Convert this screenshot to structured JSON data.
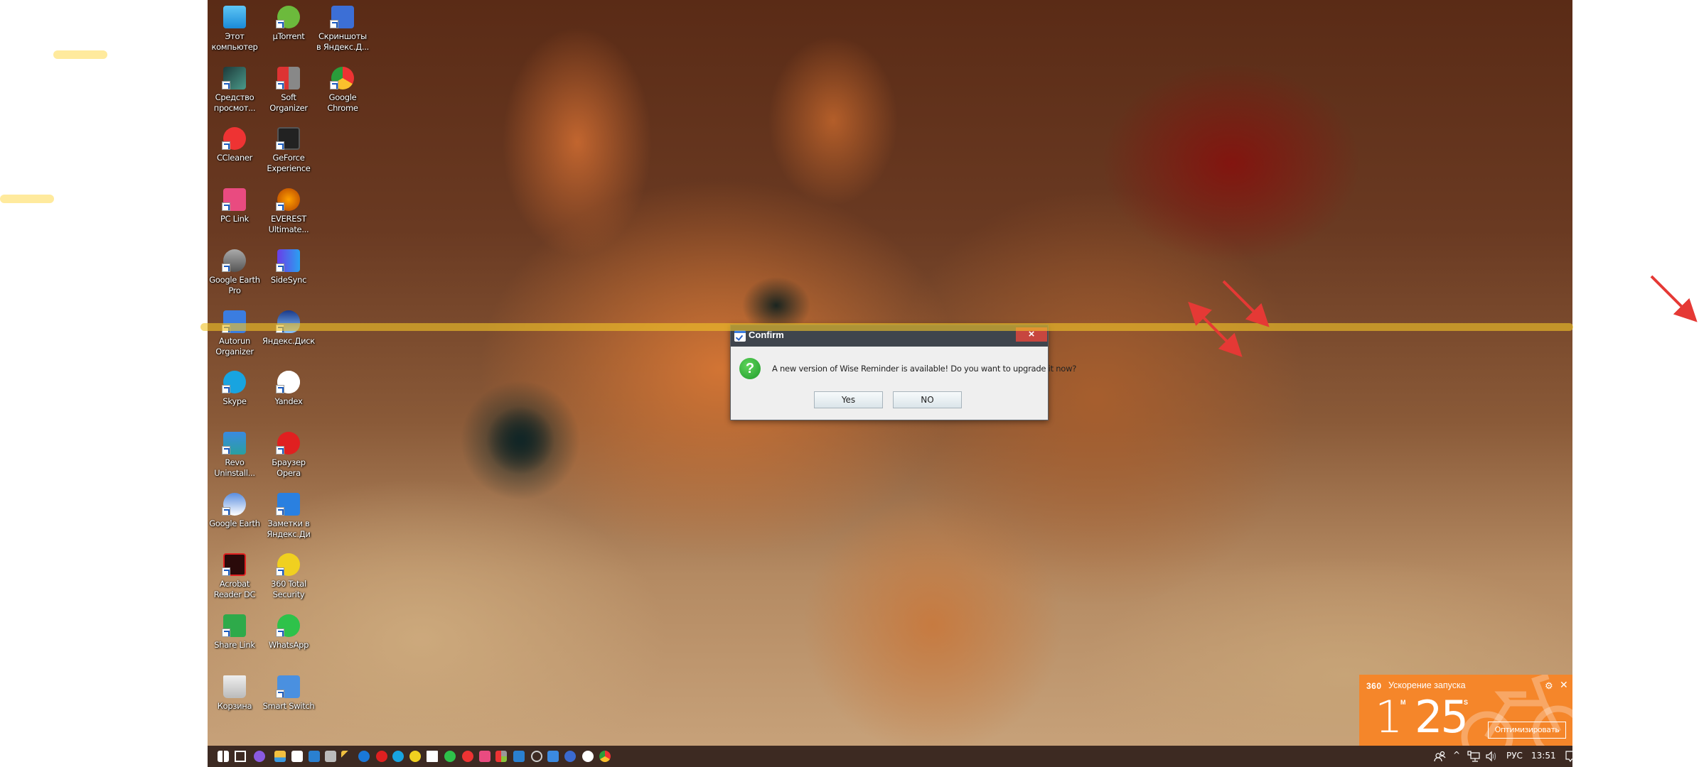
{
  "desktop_icons": [
    {
      "label": "Этот компьютер",
      "icon": "computer-icon"
    },
    {
      "label": "µTorrent",
      "icon": "utorrent-icon"
    },
    {
      "label": "Скриншоты в Яндекс.Д...",
      "icon": "screenshots-icon"
    },
    {
      "label": "Средство просмот...",
      "icon": "viewer-icon"
    },
    {
      "label": "Soft Organizer",
      "icon": "soft-organizer-icon"
    },
    {
      "label": "Google Chrome",
      "icon": "chrome-icon"
    },
    {
      "label": "CCleaner",
      "icon": "ccleaner-icon"
    },
    {
      "label": "GeForce Experience",
      "icon": "geforce-icon"
    },
    {
      "label": "PC Link",
      "icon": "pc-link-icon"
    },
    {
      "label": "EVEREST Ultimate...",
      "icon": "everest-icon"
    },
    {
      "label": "Google Earth Pro",
      "icon": "google-earth-pro-icon"
    },
    {
      "label": "SideSync",
      "icon": "sidesync-icon"
    },
    {
      "label": "Autorun Organizer",
      "icon": "autorun-organizer-icon"
    },
    {
      "label": "Яндекс.Диск",
      "icon": "yandex-disk-icon"
    },
    {
      "label": "Skype",
      "icon": "skype-icon"
    },
    {
      "label": "Yandex",
      "icon": "yandex-browser-icon"
    },
    {
      "label": "Revo Uninstall...",
      "icon": "revo-uninstaller-icon"
    },
    {
      "label": "Браузер Opera",
      "icon": "opera-icon"
    },
    {
      "label": "Google Earth",
      "icon": "google-earth-icon"
    },
    {
      "label": "Заметки в Яндекс.Ди",
      "icon": "yandex-notes-icon"
    },
    {
      "label": "Acrobat Reader DC",
      "icon": "acrobat-icon"
    },
    {
      "label": "360 Total Security",
      "icon": "360-security-icon"
    },
    {
      "label": "Share Link",
      "icon": "share-link-icon"
    },
    {
      "label": "WhatsApp",
      "icon": "whatsapp-icon"
    },
    {
      "label": "Корзина",
      "icon": "recycle-bin-icon"
    },
    {
      "label": "Smart Switch",
      "icon": "smart-switch-icon"
    }
  ],
  "dialog": {
    "title": "Confirm",
    "close": "×",
    "question_glyph": "?",
    "message": "A new version of Wise Reminder is available! Do you want to upgrade it now?",
    "yes_label": "Yes",
    "no_label": "NO"
  },
  "widget360": {
    "logo": "360",
    "title": "Ускорение запуска",
    "minutes": "1",
    "minutes_unit": "M",
    "seconds": "25",
    "seconds_unit": "S",
    "button": "Оптимизировать",
    "gear": "⚙",
    "close": "✕",
    "accent": "#f5862a"
  },
  "taskbar": {
    "apps": [
      "start",
      "task-view",
      "cortana",
      "file-explorer",
      "store",
      "control-panel",
      "camera",
      "magic-wand",
      "edge",
      "opera",
      "skype",
      "360-security",
      "mail",
      "whatsapp",
      "ccleaner",
      "pc-link",
      "flipboard-tiles",
      "revo",
      "speedometer",
      "autorun",
      "everest",
      "yandex",
      "chrome"
    ],
    "tray": {
      "people": "people-icon",
      "chevron": "^",
      "network": "network-icon",
      "volume": "volume-icon",
      "language": "РУС",
      "time": "13:51",
      "notifications": "action-center-icon"
    }
  }
}
